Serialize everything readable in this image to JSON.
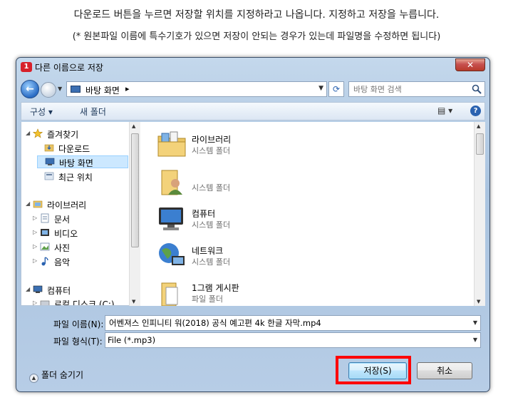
{
  "instructions": {
    "line1": "다운로드 버튼을 누르면 저장할 위치를 지정하라고 나옵니다. 지정하고 저장을 누릅니다.",
    "line2": "(* 원본파일 이름에 특수기호가 있으면 저장이 안되는 경우가 있는데 파일명을 수정하면 됩니다)"
  },
  "window": {
    "title": "다른 이름으로 저장",
    "close_label": "✕",
    "app_icon_label": "1"
  },
  "address_bar": {
    "path": "바탕 화면",
    "separator": "▸",
    "search_placeholder": "바탕 화면 검색"
  },
  "toolbar": {
    "organize": "구성 ▾",
    "new_folder": "새 폴더",
    "view_label": "▤ ▾",
    "help_label": "?"
  },
  "nav_tree": {
    "items": [
      {
        "label": "즐겨찾기",
        "arrow": "◢",
        "icon": "star-icon"
      },
      {
        "label": "다운로드",
        "arrow": "",
        "icon": "download-folder-icon"
      },
      {
        "label": "바탕 화면",
        "arrow": "",
        "icon": "desktop-icon"
      },
      {
        "label": "최근 위치",
        "arrow": "",
        "icon": "recent-places-icon"
      },
      {
        "label": "라이브러리",
        "arrow": "◢",
        "icon": "library-icon"
      },
      {
        "label": "문서",
        "arrow": "▷",
        "icon": "document-icon"
      },
      {
        "label": "비디오",
        "arrow": "▷",
        "icon": "video-icon"
      },
      {
        "label": "사진",
        "arrow": "▷",
        "icon": "picture-icon"
      },
      {
        "label": "음악",
        "arrow": "▷",
        "icon": "music-icon"
      },
      {
        "label": "컴퓨터",
        "arrow": "◢",
        "icon": "computer-icon"
      },
      {
        "label": "로컬 디스크 (C:)",
        "arrow": "▷",
        "icon": "disk-icon"
      }
    ]
  },
  "files": [
    {
      "name": "라이브러리",
      "type": "시스템 폴더",
      "icon": "library-folder-icon"
    },
    {
      "name": "",
      "type": "시스템 폴더",
      "icon": "user-folder-icon"
    },
    {
      "name": "컴퓨터",
      "type": "시스템 폴더",
      "icon": "computer-icon"
    },
    {
      "name": "네트워크",
      "type": "시스템 폴더",
      "icon": "network-icon"
    },
    {
      "name": "1그램 게시판",
      "type": "파일 폴더",
      "icon": "folder-icon"
    }
  ],
  "form": {
    "filename_label": "파일 이름(N):",
    "filename_value": "어벤져스 인피니티 워(2018) 공식 예고편 4k 한글 자막.mp4",
    "filetype_label": "파일 형식(T):",
    "filetype_value": "File (*.mp3)"
  },
  "footer": {
    "hide_folders": "폴더 숨기기",
    "save": "저장(S)",
    "cancel": "취소"
  },
  "colors": {
    "highlight": "#ff0000",
    "titlebar": "#b7cde6"
  }
}
